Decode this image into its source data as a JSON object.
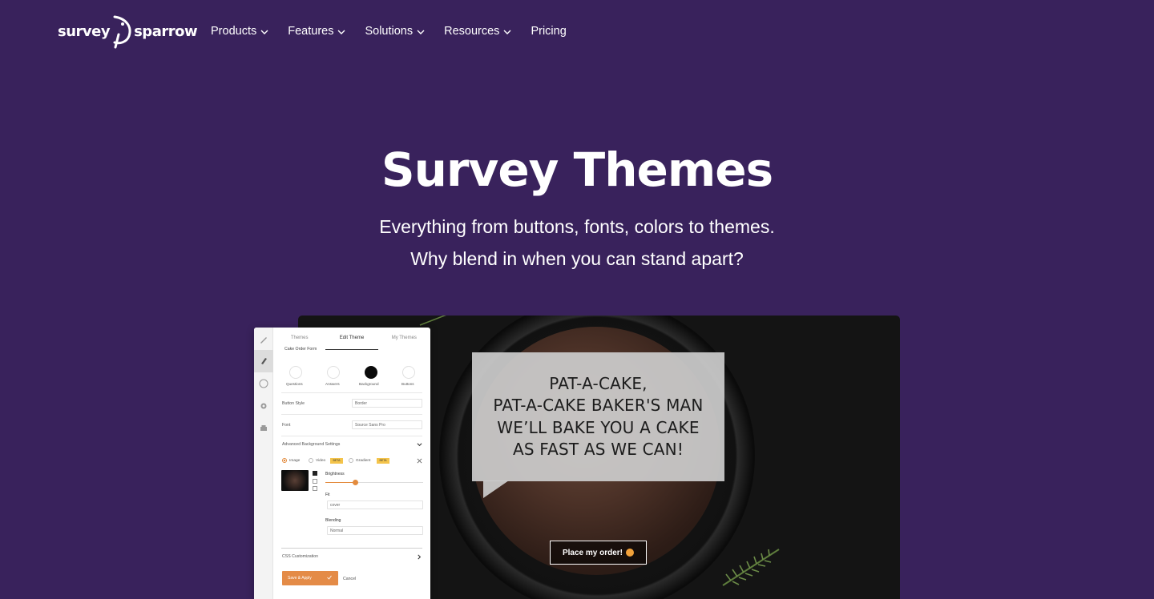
{
  "brand": {
    "logo_left": "survey",
    "logo_right": "sparrow"
  },
  "nav": {
    "items": [
      {
        "label": "Products",
        "has_dropdown": true
      },
      {
        "label": "Features",
        "has_dropdown": true
      },
      {
        "label": "Solutions",
        "has_dropdown": true
      },
      {
        "label": "Resources",
        "has_dropdown": true
      },
      {
        "label": "Pricing",
        "has_dropdown": false
      }
    ]
  },
  "hero": {
    "title": "Survey Themes",
    "subtitle_line1": "Everything from buttons, fonts, colors to themes.",
    "subtitle_line2": "Why blend in when you can stand apart?"
  },
  "preview": {
    "bubble_lines": [
      "PAT-A-CAKE,",
      "PAT-A-CAKE BAKER'S MAN",
      "WE’LL BAKE YOU A CAKE",
      "AS FAST AS WE CAN!"
    ],
    "cta_label": "Place my order!"
  },
  "editor": {
    "tabs": [
      "Themes",
      "Edit Theme",
      "My Themes"
    ],
    "active_tab": "Edit Theme",
    "section_heading": "Cake Order Form",
    "color_targets": [
      "Questions",
      "Answers",
      "Background",
      "Buttons"
    ],
    "selected_color_target": "Background",
    "button_style_label": "Button Style",
    "button_style_value": "Border",
    "font_label": "Font",
    "font_value": "Source Sans Pro",
    "advanced_label": "Advanced Background Settings",
    "bg_types": [
      "Image",
      "Video",
      "Gradient"
    ],
    "bg_type_selected": "Image",
    "beta_badge": "BETA",
    "brightness_label": "Brightness",
    "brightness_value": 0.31,
    "fit_label": "Fit",
    "fit_value": "cover",
    "blending_label": "Blending",
    "blending_value": "Normal",
    "css_label": "CSS Customization",
    "save_label": "Save & Apply",
    "cancel_label": "Cancel"
  },
  "colors": {
    "page_bg": "#39225c",
    "accent_orange": "#e48b47",
    "badge_yellow": "#f4c44b"
  },
  "icons": [
    "chevron-down-icon",
    "pen-icon",
    "brush-icon",
    "palette-icon",
    "gear-icon",
    "print-icon",
    "close-icon",
    "chevron-right-icon",
    "check-icon"
  ]
}
